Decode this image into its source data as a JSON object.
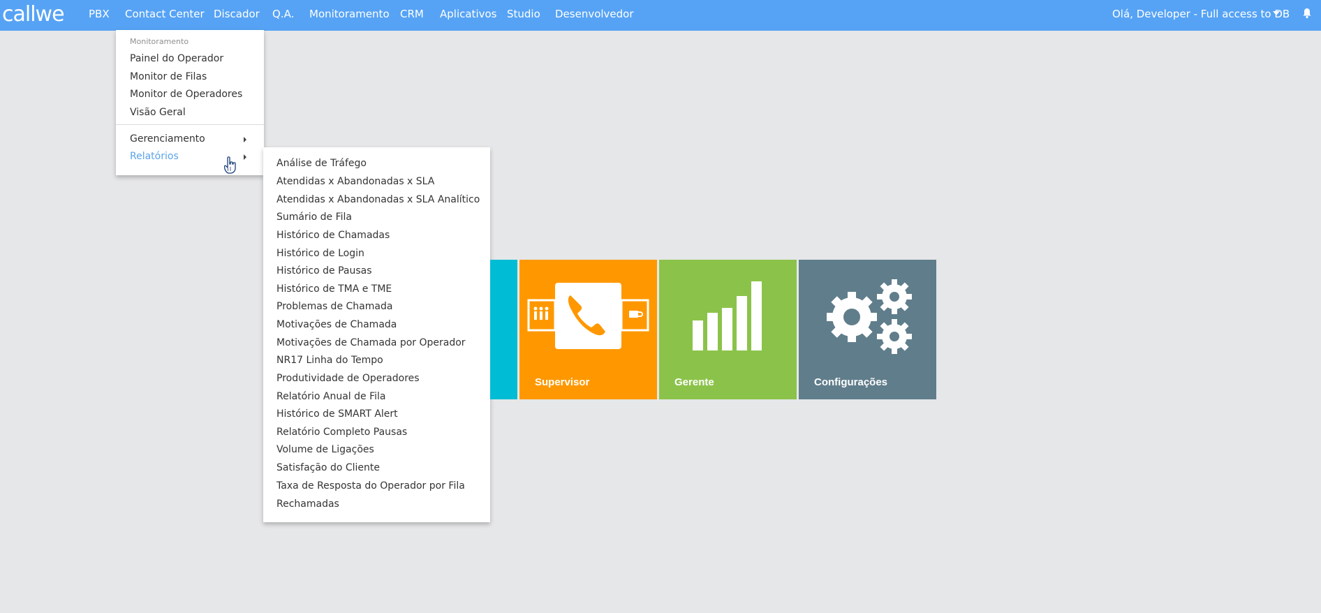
{
  "brand": {
    "logo_text": "callwe"
  },
  "nav": {
    "items": [
      {
        "label": "PBX"
      },
      {
        "label": "Contact Center"
      },
      {
        "label": "Discador"
      },
      {
        "label": "Q.A."
      },
      {
        "label": "Monitoramento"
      },
      {
        "label": "CRM"
      },
      {
        "label": "Aplicativos"
      },
      {
        "label": "Studio"
      },
      {
        "label": "Desenvolvedor"
      }
    ],
    "user_label": "Olá, Developer - Full access to DB"
  },
  "dropdown": {
    "header": "Monitoramento",
    "items": [
      {
        "label": "Painel do Operador"
      },
      {
        "label": "Monitor de Filas"
      },
      {
        "label": "Monitor de Operadores"
      },
      {
        "label": "Visão Geral"
      }
    ],
    "submenus": [
      {
        "label": "Gerenciamento"
      },
      {
        "label": "Relatórios"
      }
    ]
  },
  "reports_submenu": {
    "items": [
      {
        "label": "Análise de Tráfego"
      },
      {
        "label": "Atendidas x Abandonadas x SLA"
      },
      {
        "label": "Atendidas x Abandonadas x SLA Analítico"
      },
      {
        "label": "Sumário de Fila"
      },
      {
        "label": "Histórico de Chamadas"
      },
      {
        "label": "Histórico de Login"
      },
      {
        "label": "Histórico de Pausas"
      },
      {
        "label": "Histórico de TMA e TME"
      },
      {
        "label": "Problemas de Chamada"
      },
      {
        "label": "Motivações de Chamada"
      },
      {
        "label": "Motivações de Chamada por Operador"
      },
      {
        "label": "NR17 Linha do Tempo"
      },
      {
        "label": "Produtividade de Operadores"
      },
      {
        "label": "Relatório Anual de Fila"
      },
      {
        "label": "Histórico de SMART Alert"
      },
      {
        "label": "Relatório Completo Pausas"
      },
      {
        "label": "Volume de Ligações"
      },
      {
        "label": "Satisfação do Cliente"
      },
      {
        "label": "Taxa de Resposta do Operador por Fila"
      },
      {
        "label": "Rechamadas"
      }
    ]
  },
  "tiles": [
    {
      "label": "",
      "color": "#00bcd4"
    },
    {
      "label": "Supervisor",
      "color": "#ff9800"
    },
    {
      "label": "Gerente",
      "color": "#8bc34a"
    },
    {
      "label": "Configurações",
      "color": "#607d8b"
    }
  ],
  "colors": {
    "topbar": "#56a3f5",
    "active_link": "#5aa3ea",
    "background": "#e6e7e9"
  }
}
